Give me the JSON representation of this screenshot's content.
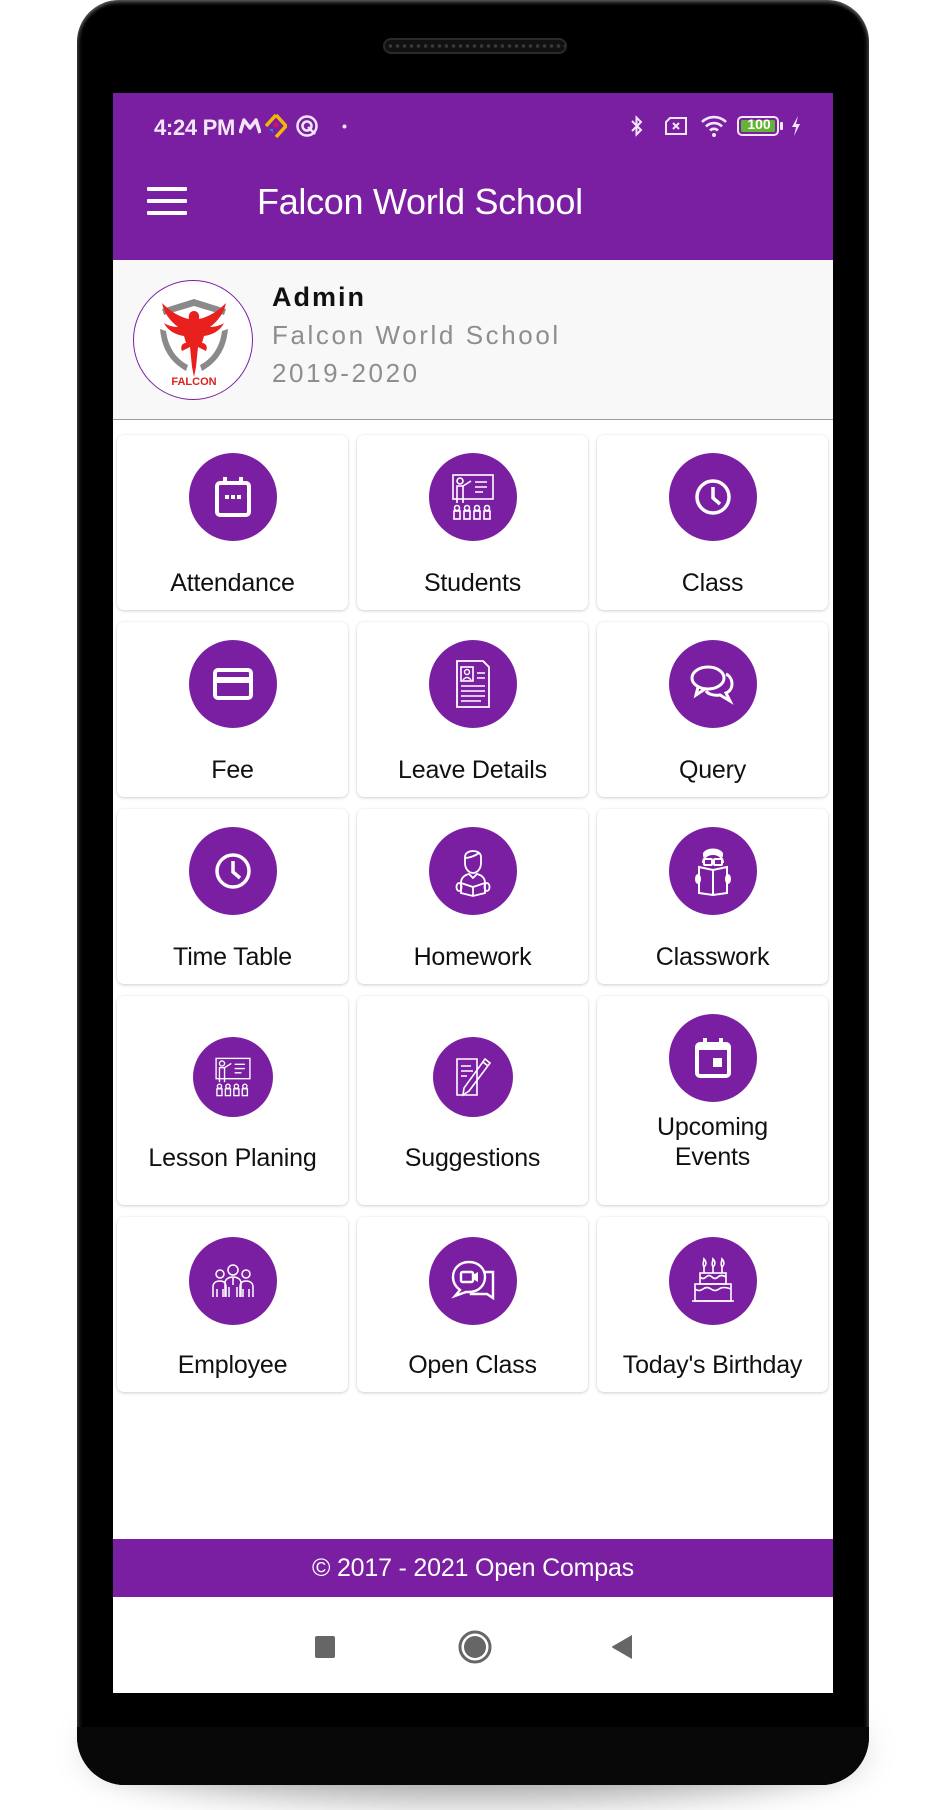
{
  "status_bar": {
    "time": "4:24 PM",
    "left_icons": [
      "m-app-icon",
      "direction-app-icon",
      "q-app-icon",
      "dot-notification-icon"
    ],
    "right_icons": [
      "bluetooth-icon",
      "no-sim-icon",
      "wifi-icon",
      "battery-icon",
      "charging-icon"
    ],
    "battery_level": "100"
  },
  "header": {
    "menu_icon": "hamburger-menu-icon",
    "title": "Falcon World School",
    "color": "#7B1FA2"
  },
  "profile": {
    "logo_text": "FALCON",
    "name": "Admin",
    "school": "Falcon World School",
    "session": "2019-2020"
  },
  "menu": {
    "items": [
      {
        "label": "Attendance",
        "icon": "calendar-icon"
      },
      {
        "label": "Students",
        "icon": "teacher-board-icon"
      },
      {
        "label": "Class",
        "icon": "clock-icon"
      },
      {
        "label": "Fee",
        "icon": "credit-card-icon"
      },
      {
        "label": "Leave Details",
        "icon": "document-profile-icon"
      },
      {
        "label": "Query",
        "icon": "chat-bubbles-icon"
      },
      {
        "label": "Time Table",
        "icon": "clock-icon"
      },
      {
        "label": "Homework",
        "icon": "student-reading-icon"
      },
      {
        "label": "Classwork",
        "icon": "reading-glasses-icon"
      },
      {
        "label": "Lesson Planing",
        "icon": "teacher-board-icon"
      },
      {
        "label": "Suggestions",
        "icon": "note-pencil-icon"
      },
      {
        "label": "Upcoming",
        "label2": "Events",
        "icon": "event-calendar-icon"
      },
      {
        "label": "Employee",
        "icon": "group-people-icon"
      },
      {
        "label": "Open Class",
        "icon": "video-chat-icon"
      },
      {
        "label": "Today's Birthday",
        "icon": "birthday-cake-icon"
      }
    ]
  },
  "footer": {
    "text": "© 2017 - 2021 Open Compas"
  },
  "nav": {
    "recents": "recents-button",
    "home": "home-button",
    "back": "back-button"
  }
}
